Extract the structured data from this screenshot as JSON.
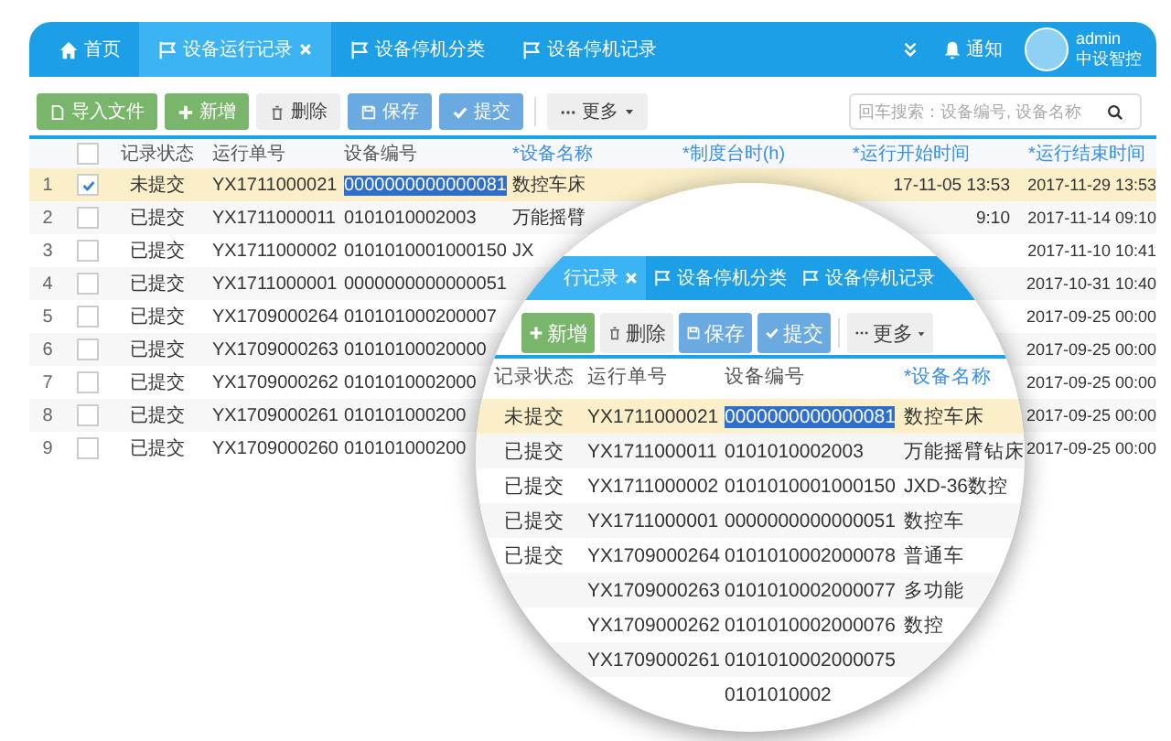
{
  "header": {
    "tabs": [
      {
        "label": "首页",
        "kind": "home",
        "selected": false,
        "closable": false
      },
      {
        "label": "设备运行记录",
        "kind": "flag",
        "selected": true,
        "closable": true
      },
      {
        "label": "设备停机分类",
        "kind": "flag",
        "selected": false,
        "closable": false
      },
      {
        "label": "设备停机记录",
        "kind": "flag",
        "selected": false,
        "closable": false
      }
    ],
    "notice": "通知",
    "user": {
      "name": "admin",
      "org": "中设智控"
    }
  },
  "toolbar": {
    "buttons": [
      {
        "label": "导入文件",
        "kind": "import"
      },
      {
        "label": "新增",
        "kind": "add"
      },
      {
        "label": "删除",
        "kind": "delete"
      },
      {
        "label": "保存",
        "kind": "save"
      },
      {
        "label": "提交",
        "kind": "submit"
      },
      {
        "label": "更多",
        "kind": "more"
      }
    ],
    "search": {
      "placeholder": "回车搜索：设备编号, 设备名称"
    }
  },
  "table": {
    "select_all": {
      "checked": false
    },
    "columns": [
      {
        "label": "记录状态",
        "editable": false
      },
      {
        "label": "运行单号",
        "editable": false
      },
      {
        "label": "设备编号",
        "editable": false
      },
      {
        "label": "*设备名称",
        "editable": true
      },
      {
        "label": "*制度台时(h)",
        "editable": true
      },
      {
        "label": "*运行开始时间",
        "editable": true
      },
      {
        "label": "*运行结束时间",
        "editable": true
      }
    ],
    "rows": [
      {
        "index": "1",
        "checked": true,
        "selected": true,
        "device_no_selected": true,
        "status": "未提交",
        "run_no": "YX1711000021",
        "device_no": "0000000000000081",
        "device_name": "数控车床",
        "start": "17-11-05 13:53",
        "end": "2017-11-29 13:53"
      },
      {
        "index": "2",
        "checked": false,
        "selected": false,
        "device_no_selected": false,
        "status": "已提交",
        "run_no": "YX1711000011",
        "device_no": "0101010002003",
        "device_name": "万能摇臂",
        "start": "9:10",
        "end": "2017-11-14 09:10"
      },
      {
        "index": "3",
        "checked": false,
        "selected": false,
        "device_no_selected": false,
        "status": "已提交",
        "run_no": "YX1711000002",
        "device_no": "0101010001000150",
        "device_name": "JX",
        "end": "2017-11-10 10:41"
      },
      {
        "index": "4",
        "checked": false,
        "selected": false,
        "device_no_selected": false,
        "status": "已提交",
        "run_no": "YX1711000001",
        "device_no": "0000000000000051",
        "end": "2017-10-31 10:40"
      },
      {
        "index": "5",
        "checked": false,
        "selected": false,
        "device_no_selected": false,
        "status": "已提交",
        "run_no": "YX1709000264",
        "device_no": "010101000200007",
        "end": "2017-09-25 00:00"
      },
      {
        "index": "6",
        "checked": false,
        "selected": false,
        "device_no_selected": false,
        "status": "已提交",
        "run_no": "YX1709000263",
        "device_no": "01010100020000",
        "end": "2017-09-25 00:00"
      },
      {
        "index": "7",
        "checked": false,
        "selected": false,
        "device_no_selected": false,
        "status": "已提交",
        "run_no": "YX1709000262",
        "device_no": "0101010002000",
        "end": "2017-09-25 00:00"
      },
      {
        "index": "8",
        "checked": false,
        "selected": false,
        "device_no_selected": false,
        "status": "已提交",
        "run_no": "YX1709000261",
        "device_no": "010101000200",
        "end": "2017-09-25 00:00"
      },
      {
        "index": "9",
        "checked": false,
        "selected": false,
        "device_no_selected": false,
        "status": "已提交",
        "run_no": "YX1709000260",
        "device_no": "010101000200",
        "end": "2017-09-25 00:00"
      }
    ]
  },
  "magnifier": {
    "tabs": [
      {
        "label": "行记录",
        "kind": "plain",
        "selected": true,
        "closable": true
      },
      {
        "label": "设备停机分类",
        "kind": "flag",
        "selected": false,
        "closable": false
      },
      {
        "label": "设备停机记录",
        "kind": "flag",
        "selected": false,
        "closable": false
      }
    ],
    "buttons": [
      {
        "label": "新增",
        "kind": "add"
      },
      {
        "label": "删除",
        "kind": "delete"
      },
      {
        "label": "保存",
        "kind": "save"
      },
      {
        "label": "提交",
        "kind": "submit"
      },
      {
        "label": "更多",
        "kind": "more"
      }
    ],
    "columns": [
      {
        "label": "记录状态",
        "editable": false
      },
      {
        "label": "运行单号",
        "editable": false
      },
      {
        "label": "设备编号",
        "editable": false
      },
      {
        "label": "*设备名称",
        "editable": true
      }
    ],
    "rows": [
      {
        "selected": true,
        "device_no_selected": true,
        "status": "未提交",
        "run_no": "YX1711000021",
        "device_no": "0000000000000081",
        "device_name": "数控车床"
      },
      {
        "selected": false,
        "device_no_selected": false,
        "status": "已提交",
        "run_no": "YX1711000011",
        "device_no": "0101010002003",
        "device_name": "万能摇臂钻床"
      },
      {
        "selected": false,
        "device_no_selected": false,
        "status": "已提交",
        "run_no": "YX1711000002",
        "device_no": "0101010001000150",
        "device_name": "JXD-36数控"
      },
      {
        "selected": false,
        "device_no_selected": false,
        "status": "已提交",
        "run_no": "YX1711000001",
        "device_no": "0000000000000051",
        "device_name": "数控车"
      },
      {
        "selected": false,
        "device_no_selected": false,
        "status": "已提交",
        "run_no": "YX1709000264",
        "device_no": "0101010002000078",
        "device_name": "普通车"
      },
      {
        "selected": false,
        "device_no_selected": false,
        "run_no": "YX1709000263",
        "device_no": "0101010002000077",
        "device_name": "多功能"
      },
      {
        "selected": false,
        "device_no_selected": false,
        "run_no": "YX1709000262",
        "device_no": "0101010002000076",
        "device_name": "数控"
      },
      {
        "selected": false,
        "device_no_selected": false,
        "run_no": "YX1709000261",
        "device_no": "0101010002000075"
      },
      {
        "selected": false,
        "device_no_selected": false,
        "device_no": "0101010002"
      }
    ]
  }
}
